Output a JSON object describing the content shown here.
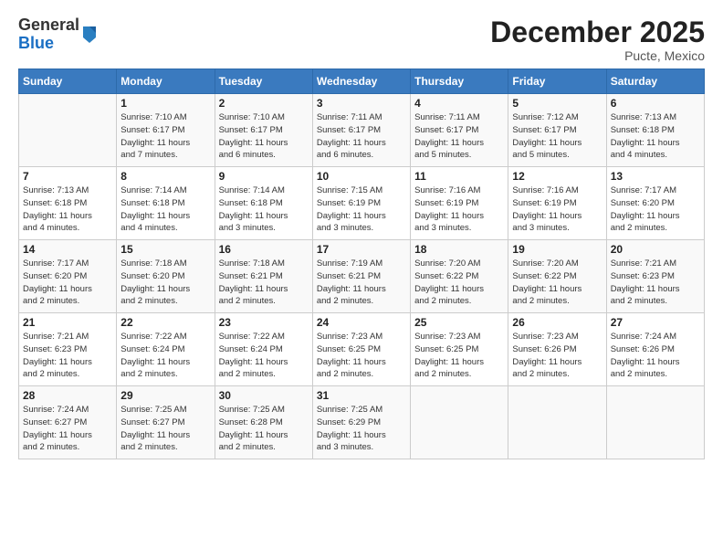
{
  "header": {
    "logo_general": "General",
    "logo_blue": "Blue",
    "month": "December 2025",
    "location": "Pucte, Mexico"
  },
  "days_of_week": [
    "Sunday",
    "Monday",
    "Tuesday",
    "Wednesday",
    "Thursday",
    "Friday",
    "Saturday"
  ],
  "weeks": [
    [
      {
        "num": "",
        "info": ""
      },
      {
        "num": "1",
        "info": "Sunrise: 7:10 AM\nSunset: 6:17 PM\nDaylight: 11 hours\nand 7 minutes."
      },
      {
        "num": "2",
        "info": "Sunrise: 7:10 AM\nSunset: 6:17 PM\nDaylight: 11 hours\nand 6 minutes."
      },
      {
        "num": "3",
        "info": "Sunrise: 7:11 AM\nSunset: 6:17 PM\nDaylight: 11 hours\nand 6 minutes."
      },
      {
        "num": "4",
        "info": "Sunrise: 7:11 AM\nSunset: 6:17 PM\nDaylight: 11 hours\nand 5 minutes."
      },
      {
        "num": "5",
        "info": "Sunrise: 7:12 AM\nSunset: 6:17 PM\nDaylight: 11 hours\nand 5 minutes."
      },
      {
        "num": "6",
        "info": "Sunrise: 7:13 AM\nSunset: 6:18 PM\nDaylight: 11 hours\nand 4 minutes."
      }
    ],
    [
      {
        "num": "7",
        "info": "Sunrise: 7:13 AM\nSunset: 6:18 PM\nDaylight: 11 hours\nand 4 minutes."
      },
      {
        "num": "8",
        "info": "Sunrise: 7:14 AM\nSunset: 6:18 PM\nDaylight: 11 hours\nand 4 minutes."
      },
      {
        "num": "9",
        "info": "Sunrise: 7:14 AM\nSunset: 6:18 PM\nDaylight: 11 hours\nand 3 minutes."
      },
      {
        "num": "10",
        "info": "Sunrise: 7:15 AM\nSunset: 6:19 PM\nDaylight: 11 hours\nand 3 minutes."
      },
      {
        "num": "11",
        "info": "Sunrise: 7:16 AM\nSunset: 6:19 PM\nDaylight: 11 hours\nand 3 minutes."
      },
      {
        "num": "12",
        "info": "Sunrise: 7:16 AM\nSunset: 6:19 PM\nDaylight: 11 hours\nand 3 minutes."
      },
      {
        "num": "13",
        "info": "Sunrise: 7:17 AM\nSunset: 6:20 PM\nDaylight: 11 hours\nand 2 minutes."
      }
    ],
    [
      {
        "num": "14",
        "info": "Sunrise: 7:17 AM\nSunset: 6:20 PM\nDaylight: 11 hours\nand 2 minutes."
      },
      {
        "num": "15",
        "info": "Sunrise: 7:18 AM\nSunset: 6:20 PM\nDaylight: 11 hours\nand 2 minutes."
      },
      {
        "num": "16",
        "info": "Sunrise: 7:18 AM\nSunset: 6:21 PM\nDaylight: 11 hours\nand 2 minutes."
      },
      {
        "num": "17",
        "info": "Sunrise: 7:19 AM\nSunset: 6:21 PM\nDaylight: 11 hours\nand 2 minutes."
      },
      {
        "num": "18",
        "info": "Sunrise: 7:20 AM\nSunset: 6:22 PM\nDaylight: 11 hours\nand 2 minutes."
      },
      {
        "num": "19",
        "info": "Sunrise: 7:20 AM\nSunset: 6:22 PM\nDaylight: 11 hours\nand 2 minutes."
      },
      {
        "num": "20",
        "info": "Sunrise: 7:21 AM\nSunset: 6:23 PM\nDaylight: 11 hours\nand 2 minutes."
      }
    ],
    [
      {
        "num": "21",
        "info": "Sunrise: 7:21 AM\nSunset: 6:23 PM\nDaylight: 11 hours\nand 2 minutes."
      },
      {
        "num": "22",
        "info": "Sunrise: 7:22 AM\nSunset: 6:24 PM\nDaylight: 11 hours\nand 2 minutes."
      },
      {
        "num": "23",
        "info": "Sunrise: 7:22 AM\nSunset: 6:24 PM\nDaylight: 11 hours\nand 2 minutes."
      },
      {
        "num": "24",
        "info": "Sunrise: 7:23 AM\nSunset: 6:25 PM\nDaylight: 11 hours\nand 2 minutes."
      },
      {
        "num": "25",
        "info": "Sunrise: 7:23 AM\nSunset: 6:25 PM\nDaylight: 11 hours\nand 2 minutes."
      },
      {
        "num": "26",
        "info": "Sunrise: 7:23 AM\nSunset: 6:26 PM\nDaylight: 11 hours\nand 2 minutes."
      },
      {
        "num": "27",
        "info": "Sunrise: 7:24 AM\nSunset: 6:26 PM\nDaylight: 11 hours\nand 2 minutes."
      }
    ],
    [
      {
        "num": "28",
        "info": "Sunrise: 7:24 AM\nSunset: 6:27 PM\nDaylight: 11 hours\nand 2 minutes."
      },
      {
        "num": "29",
        "info": "Sunrise: 7:25 AM\nSunset: 6:27 PM\nDaylight: 11 hours\nand 2 minutes."
      },
      {
        "num": "30",
        "info": "Sunrise: 7:25 AM\nSunset: 6:28 PM\nDaylight: 11 hours\nand 2 minutes."
      },
      {
        "num": "31",
        "info": "Sunrise: 7:25 AM\nSunset: 6:29 PM\nDaylight: 11 hours\nand 3 minutes."
      },
      {
        "num": "",
        "info": ""
      },
      {
        "num": "",
        "info": ""
      },
      {
        "num": "",
        "info": ""
      }
    ]
  ]
}
